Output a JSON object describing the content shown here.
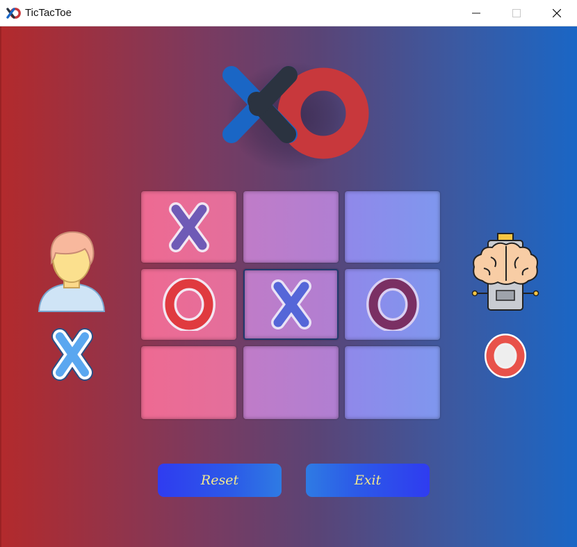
{
  "window": {
    "title": "TicTacToe",
    "controls": {
      "minimize": "minimize",
      "maximize": "maximize",
      "close": "close"
    }
  },
  "board": {
    "cells": [
      [
        "X",
        "",
        ""
      ],
      [
        "O",
        "X",
        "O"
      ],
      [
        "",
        "",
        ""
      ]
    ],
    "selected_cell": [
      1,
      1
    ]
  },
  "players": {
    "human": {
      "icon": "user-icon",
      "mark": "X"
    },
    "computer": {
      "icon": "robot-brain-icon",
      "mark": "O"
    }
  },
  "buttons": {
    "reset_label": "Reset",
    "exit_label": "Exit"
  },
  "colors": {
    "brand_blue": "#1a66c5",
    "brand_red": "#c8383c",
    "logo_dark": "#2b3340",
    "x_board": "#6f5ab6",
    "o_board_red": "#e03a3f",
    "o_board_maroon": "#7a2f63",
    "x_player": "#5aa7f0",
    "button_text": "#f2e88f"
  }
}
